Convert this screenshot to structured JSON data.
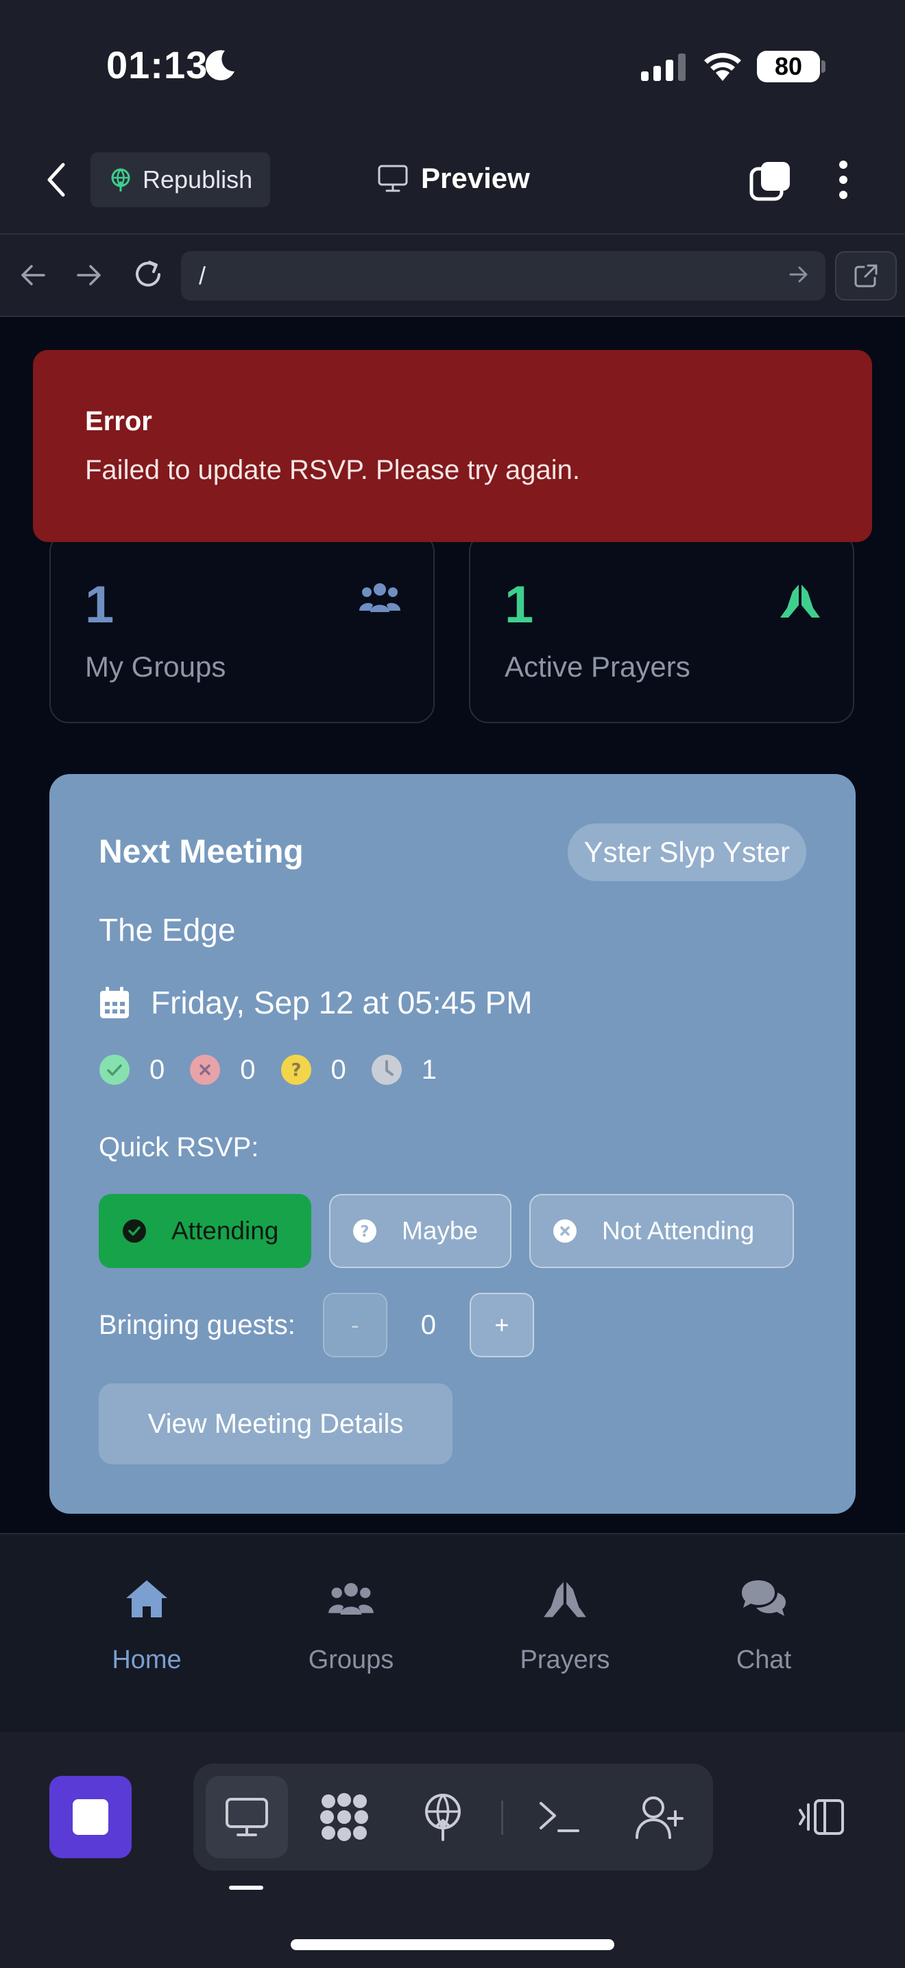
{
  "status_bar": {
    "time": "01:13",
    "battery": "80"
  },
  "app_bar": {
    "republish_label": "Republish",
    "preview_label": "Preview"
  },
  "browser": {
    "url": "/"
  },
  "error": {
    "title": "Error",
    "message": "Failed to update RSVP. Please try again."
  },
  "stats": [
    {
      "value": "1",
      "label": "My Groups",
      "color": "#6f8fc2"
    },
    {
      "value": "1",
      "label": "Active Prayers",
      "color": "#3ecf8e"
    }
  ],
  "meeting": {
    "title": "Next Meeting",
    "group": "Yster Slyp Yster",
    "name": "The Edge",
    "date": "Friday, Sep 12 at 05:45 PM",
    "counts": {
      "attending": "0",
      "not_attending": "0",
      "maybe": "0",
      "pending": "1"
    },
    "quick_rsvp_label": "Quick RSVP:",
    "rsvp_options": {
      "attending": "Attending",
      "maybe": "Maybe",
      "not_attending": "Not Attending"
    },
    "selected_rsvp": "Attending",
    "guests_label": "Bringing guests:",
    "guests_minus": "-",
    "guests_value": "0",
    "guests_plus": "+",
    "view_details_label": "View Meeting Details"
  },
  "bottom_nav": [
    {
      "label": "Home",
      "icon": "home-icon",
      "active": true
    },
    {
      "label": "Groups",
      "icon": "users-icon",
      "active": false
    },
    {
      "label": "Prayers",
      "icon": "praying-hands-icon",
      "active": false
    },
    {
      "label": "Chat",
      "icon": "chat-icon",
      "active": false
    }
  ],
  "colors": {
    "accent": "#7b9fd0",
    "error_bg": "#82191c",
    "attending_green": "#17a34a",
    "stop_purple": "#5a3bd6",
    "card_blue": "#7799be"
  }
}
